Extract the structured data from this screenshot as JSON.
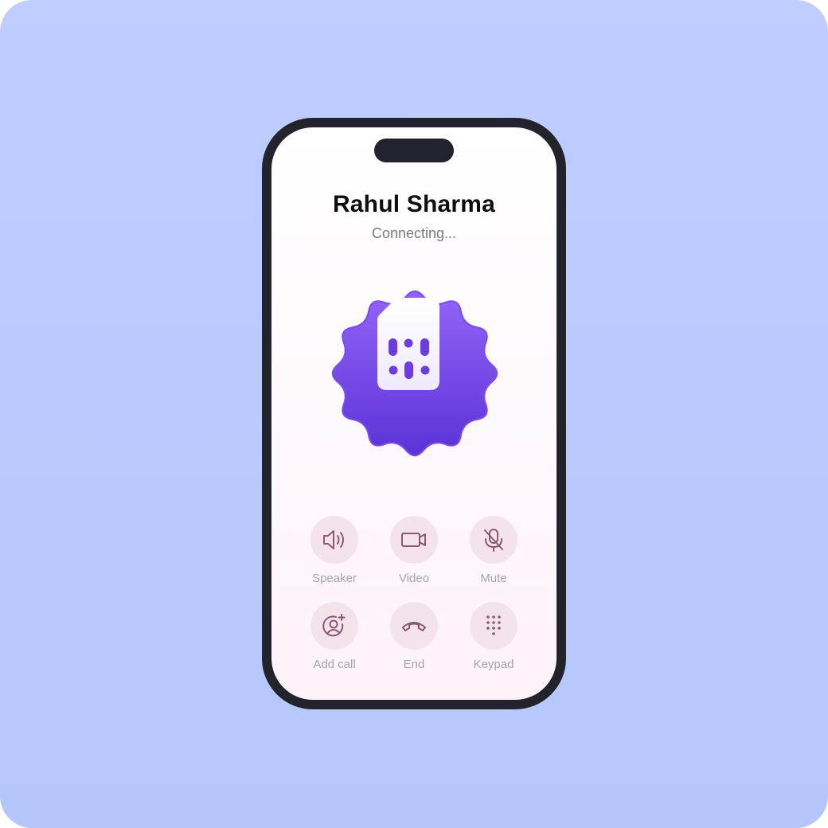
{
  "call": {
    "caller_name": "Rahul Sharma",
    "status": "Connecting..."
  },
  "controls": [
    {
      "label": "Speaker",
      "icon": "speaker-icon"
    },
    {
      "label": "Video",
      "icon": "video-camera-icon"
    },
    {
      "label": "Mute",
      "icon": "microphone-off-icon"
    },
    {
      "label": "Add call",
      "icon": "add-user-icon"
    },
    {
      "label": "End",
      "icon": "hang-up-phone-icon"
    },
    {
      "label": "Keypad",
      "icon": "keypad-icon"
    }
  ],
  "badge": {
    "icon": "sim-card-icon",
    "colors": {
      "badge_top": "#9464f8",
      "badge_bottom": "#5a32d6",
      "sim": "#ffffff"
    }
  },
  "colors": {
    "background": "#bccbfe",
    "phone_frame": "#23232c",
    "control_circle": "#f4e3ec",
    "control_icon": "#8a5a6f",
    "control_label": "#a9a2ac"
  }
}
